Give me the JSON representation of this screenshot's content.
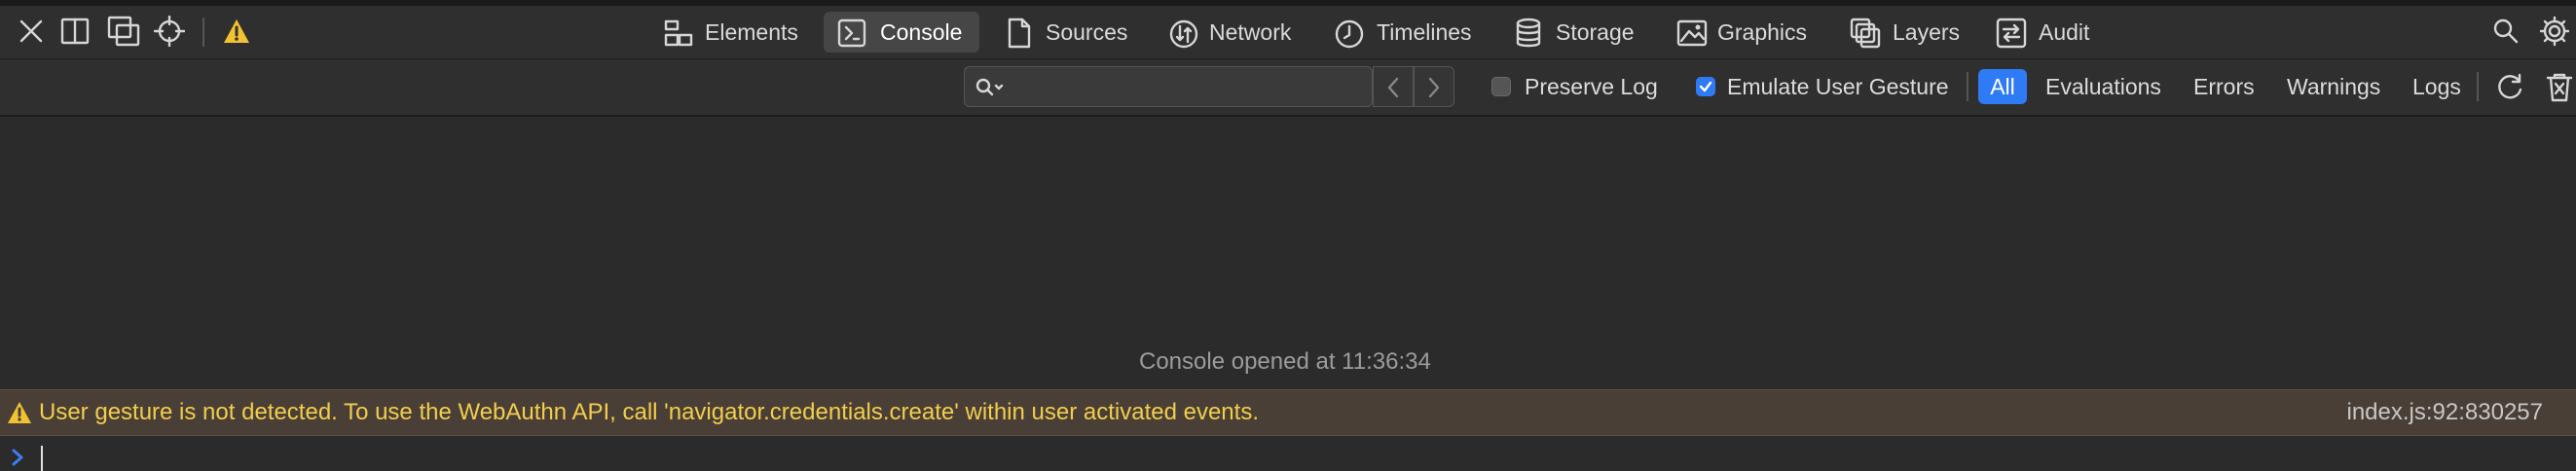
{
  "toolbar": {
    "tabs": [
      {
        "label": "Elements",
        "icon": "elements-icon"
      },
      {
        "label": "Console",
        "icon": "console-icon",
        "active": true
      },
      {
        "label": "Sources",
        "icon": "sources-icon"
      },
      {
        "label": "Network",
        "icon": "network-icon"
      },
      {
        "label": "Timelines",
        "icon": "timelines-icon"
      },
      {
        "label": "Storage",
        "icon": "storage-icon"
      },
      {
        "label": "Graphics",
        "icon": "graphics-icon"
      },
      {
        "label": "Layers",
        "icon": "layers-icon"
      },
      {
        "label": "Audit",
        "icon": "audit-icon"
      }
    ],
    "left_icons": [
      "close-icon",
      "dock-side-icon",
      "undock-icon",
      "target-icon",
      "warning-icon"
    ],
    "right_icons": [
      "search-icon",
      "settings-icon"
    ]
  },
  "filterbar": {
    "search": {
      "placeholder": "",
      "value": ""
    },
    "preserve_log": {
      "label": "Preserve Log",
      "checked": false
    },
    "emulate_gesture": {
      "label": "Emulate User Gesture",
      "checked": true
    },
    "levels": [
      {
        "label": "All",
        "active": true
      },
      {
        "label": "Evaluations"
      },
      {
        "label": "Errors"
      },
      {
        "label": "Warnings"
      },
      {
        "label": "Logs"
      }
    ]
  },
  "console": {
    "opened_text": "Console opened at 11:36:34",
    "messages": [
      {
        "level": "warning",
        "text": "User gesture is not detected. To use the WebAuthn API, call 'navigator.credentials.create' within user activated events.",
        "source": "index.js:92:830257"
      }
    ]
  },
  "colors": {
    "accent": "#2f7bf5",
    "warning_text": "#f2ce4b",
    "warning_bg": "#4a3f37",
    "background": "#2b2b2b"
  }
}
